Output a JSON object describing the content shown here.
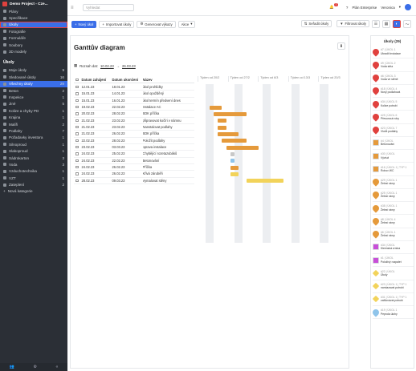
{
  "project": {
    "name": "Demo Project - Cze..."
  },
  "sidebar": {
    "top_items": [
      {
        "label": "Plány",
        "icon": "map-icon"
      },
      {
        "label": "Specifikace",
        "icon": "document-icon"
      },
      {
        "label": "Úkoly",
        "icon": "tasks-icon"
      },
      {
        "label": "Fotografie",
        "icon": "photo-icon"
      },
      {
        "label": "Formuláře",
        "icon": "form-icon"
      },
      {
        "label": "Soubory",
        "icon": "folder-icon"
      },
      {
        "label": "3D modely",
        "icon": "cube-icon"
      }
    ],
    "section_title": "Úkoly",
    "task_items": [
      {
        "label": "Moje úkoly",
        "count": "9"
      },
      {
        "label": "Sledované úkoly",
        "count": "16"
      },
      {
        "label": "Všechny úkoly",
        "count": "29"
      },
      {
        "label": "Beton",
        "count": "2"
      },
      {
        "label": "Inspekce",
        "count": "1"
      },
      {
        "label": "Jiné",
        "count": "5"
      },
      {
        "label": "Kolize a chyby PD",
        "count": "1"
      },
      {
        "label": "Krajina",
        "count": "1"
      },
      {
        "label": "Malíři",
        "count": "2"
      },
      {
        "label": "Podlahy",
        "count": "7"
      },
      {
        "label": "Požadavky investora",
        "count": "1"
      },
      {
        "label": "Silnoproud",
        "count": "1"
      },
      {
        "label": "Slaboproud",
        "count": "1"
      },
      {
        "label": "Sádrokarton",
        "count": "3"
      },
      {
        "label": "Voda",
        "count": "3"
      },
      {
        "label": "Vzduchotechnika",
        "count": "1"
      },
      {
        "label": "VZT",
        "count": "1"
      },
      {
        "label": "Zateplení",
        "count": "2"
      }
    ],
    "new_category": "Nová kategorie"
  },
  "topbar": {
    "search_placeholder": "Vyhledat",
    "notifications_count": "7",
    "plan_label": "Plán Enterprise",
    "user_name": "Veronica"
  },
  "toolbar": {
    "new_task": "Nový úkol",
    "import_tasks": "Importovat úkoly",
    "generate_reports": "Generovat výkazy",
    "actions": "Akce",
    "sort_tasks": "Seřadit úkoly",
    "filter_tasks": "Filtrovat úkoly"
  },
  "gantt": {
    "title": "Ganttův diagram",
    "range_label": "Rozsah dat:",
    "range_from": "10.02.23",
    "range_to": "26.03.23",
    "columns": [
      "Datum zahájení",
      "Datum ukončení",
      "Název"
    ],
    "weeks": [
      "Týden od 20/2",
      "Týden od 27/2",
      "Týden od 6/3",
      "Týden od 13/3",
      "Týden od 20/3"
    ],
    "rows": [
      {
        "start": "12.01.23",
        "end": "18.01.23",
        "name": "úkol prohlídky"
      },
      {
        "start": "15.01.23",
        "end": "14.01.23",
        "name": "úkol opožděný"
      },
      {
        "start": "15.01.23",
        "end": "16.01.23",
        "name": "úkol termín předvení dnes"
      },
      {
        "start": "19.02.23",
        "end": "22.02.23",
        "name": "Instalace AC"
      },
      {
        "start": "20.02.23",
        "end": "28.02.23",
        "name": "SDK příčka"
      },
      {
        "start": "21.02.23",
        "end": "23.02.23",
        "name": "připravovat kočíri v námnu"
      },
      {
        "start": "21.02.23",
        "end": "23.02.23",
        "name": "Nanstalovat podlahy"
      },
      {
        "start": "21.02.23",
        "end": "26.02.23",
        "name": "SDK příčka"
      },
      {
        "start": "22.02.23",
        "end": "28.02.23",
        "name": "Položit podlahy"
      },
      {
        "start": "23.02.23",
        "end": "03.03.23",
        "name": "oprava instalace"
      },
      {
        "start": "24.02.23",
        "end": "25.02.23",
        "name": "Chybějící rozetazubáků"
      },
      {
        "start": "24.02.23",
        "end": "22.02.23",
        "name": "Betonování"
      },
      {
        "start": "24.02.23",
        "end": "26.02.23",
        "name": "Příčka"
      },
      {
        "start": "24.02.23",
        "end": "26.02.23",
        "name": "Křivá záruběň"
      },
      {
        "start": "28.02.23",
        "end": "09.03.23",
        "name": "Vymalovat stěny"
      }
    ]
  },
  "tasks_panel": {
    "title": "Úkoly (29)",
    "items": [
      {
        "id": "#7 | ÚKOL 1",
        "name": "Ukradit instalace",
        "color": "#e0413e",
        "shape": "drop"
      },
      {
        "id": "#9 | ÚKOL 2",
        "name": "Voda stěa",
        "color": "#e0413e",
        "shape": "drop"
      },
      {
        "id": "#6 | ÚKOL 3",
        "name": "Voda ve stěně",
        "color": "#e0413e",
        "shape": "drop"
      },
      {
        "id": "#18 | ÚKOL 4",
        "name": "Nový podlahová",
        "color": "#e0413e",
        "shape": "drop"
      },
      {
        "id": "#34 | ÚKOL 5",
        "name": "Kolize potrubí",
        "color": "#e0413e",
        "shape": "drop"
      },
      {
        "id": "#25 | ÚKOL 6",
        "name": "Přesunout rohy",
        "color": "#e0413e",
        "shape": "drop"
      },
      {
        "id": "#23 | ÚKOL 7",
        "name": "Vložit podlahy",
        "color": "#e0413e",
        "shape": "drop"
      },
      {
        "id": "#4 | ÚKOL",
        "name": "Betonování",
        "color": "#e59a3b",
        "shape": "sq"
      },
      {
        "id": "#30 | ÚKOL",
        "name": "Výztuž",
        "color": "#e59a3b",
        "shape": "sq"
      },
      {
        "id": "#16 | ÚKOL 1 | TYP 1",
        "name": "Rohov WC",
        "color": "#e59a3b",
        "shape": "sq"
      },
      {
        "id": "#29 | ÚKOL 1",
        "name": "Železí rámy",
        "color": "#e59a3b",
        "shape": "drop"
      },
      {
        "id": "#25 | ÚKOL 1",
        "name": "Železí rámy",
        "color": "#e59a3b",
        "shape": "drop"
      },
      {
        "id": "#38 | ÚKOL 1",
        "name": "Železí rámy",
        "color": "#e59a3b",
        "shape": "drop"
      },
      {
        "id": "#8 | ÚKOL 4",
        "name": "Železí rámy",
        "color": "#e59a3b",
        "shape": "drop"
      },
      {
        "id": "#6 | ÚKOL 1",
        "name": "Železí rámy",
        "color": "#e59a3b",
        "shape": "drop"
      },
      {
        "id": "#34 | ÚKOL",
        "name": "Kleenská zrnina",
        "color": "#c84fd8",
        "shape": "sq"
      },
      {
        "id": "#1 | ÚKOL",
        "name": "Položivý rozpalet",
        "color": "#c84fd8",
        "shape": "sq"
      },
      {
        "id": "#22 | ÚKOL",
        "name": "Úkoly",
        "color": "#f2d35a",
        "shape": "dia"
      },
      {
        "id": "#23 | ÚKOL 1 | TYP 1",
        "name": "namiazavat potrubí",
        "color": "#f2d35a",
        "shape": "dia"
      },
      {
        "id": "#31 | ÚKOL 1 | TYP 1",
        "name": "zaMovávat potrubí",
        "color": "#f2d35a",
        "shape": "dia"
      },
      {
        "id": "#19 | ÚKOL 1",
        "name": "Peprola úlohy",
        "color": "#8fc4ea",
        "shape": "drop"
      }
    ]
  }
}
